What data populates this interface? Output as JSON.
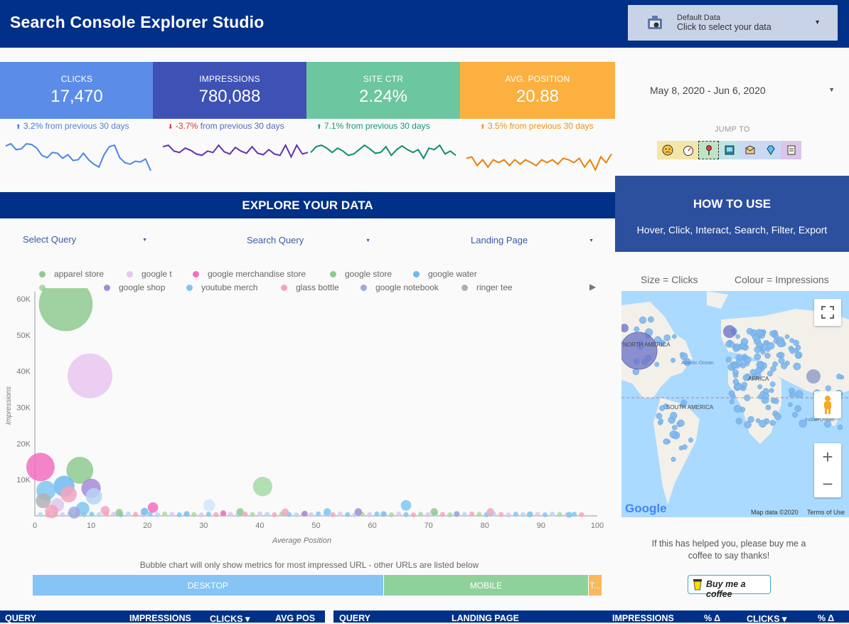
{
  "header": {
    "title": "Search Console Explorer Studio",
    "data_selector": {
      "label": "Default Data",
      "value": "Click to select your data"
    }
  },
  "colors": {
    "navy": "#003087",
    "clicks": "#5b8de8",
    "impressions": "#3e51b5",
    "ctr": "#6cc6a0",
    "position": "#fbb040",
    "howto_bg": "#2c4f9e"
  },
  "kpis": [
    {
      "label": "CLICKS",
      "value": "17,470",
      "change": "3.2%",
      "change_text": "from previous 30 days",
      "direction": "up"
    },
    {
      "label": "IMPRESSIONS",
      "value": "780,088",
      "change": "-3.7%",
      "change_text": "from previous 30 days",
      "direction": "down"
    },
    {
      "label": "SITE CTR",
      "value": "2.24%",
      "change": "7.1%",
      "change_text": "from previous 30 days",
      "direction": "up"
    },
    {
      "label": "AVG. POSITION",
      "value": "20.88",
      "change": "3.5%",
      "change_text": "from previous 30 days",
      "direction": "up"
    }
  ],
  "sparklines": {
    "clicks": [
      41,
      44,
      36,
      37,
      44,
      43,
      38,
      28,
      25,
      32,
      31,
      24,
      29,
      21,
      22,
      31,
      22,
      16,
      12,
      29,
      40,
      42,
      25,
      18,
      16,
      20,
      19,
      23,
      7
    ],
    "impressions": [
      40,
      42,
      34,
      32,
      38,
      35,
      30,
      28,
      34,
      32,
      42,
      33,
      30,
      39,
      34,
      31,
      40,
      31,
      29,
      36,
      30,
      28,
      42,
      26,
      42,
      30,
      32
    ],
    "ctr": [
      32,
      40,
      42,
      38,
      32,
      38,
      34,
      28,
      30,
      36,
      42,
      37,
      31,
      32,
      40,
      28,
      36,
      41,
      36,
      32,
      36,
      24,
      38,
      36,
      42,
      30,
      34,
      28
    ],
    "position": [
      24,
      26,
      14,
      22,
      12,
      22,
      18,
      22,
      14,
      22,
      16,
      22,
      18,
      14,
      22,
      18,
      22,
      16,
      24,
      22,
      18,
      24,
      12,
      22,
      8,
      26,
      18,
      30
    ]
  },
  "date_range": "May 8, 2020 - Jun 6, 2020",
  "jump_to": {
    "label": "JUMP TO",
    "buttons": [
      {
        "icon": "sad-face-icon",
        "bg": "#f4e6a8"
      },
      {
        "icon": "gauge-icon",
        "bg": "#f4e6a8"
      },
      {
        "icon": "map-pin-icon",
        "bg": "#bfe3c5"
      },
      {
        "icon": "book-icon",
        "bg": "#bfe3e8"
      },
      {
        "icon": "folder-icon",
        "bg": "#c9d9f4"
      },
      {
        "icon": "diamond-icon",
        "bg": "#c9d9f4"
      },
      {
        "icon": "scroll-icon",
        "bg": "#dcc5ea"
      }
    ]
  },
  "howto": {
    "title": "HOW TO USE",
    "text": "Hover, Click, Interact, Search, Filter, Export"
  },
  "explore": {
    "title": "EXPLORE YOUR DATA"
  },
  "filters": [
    {
      "label": "Select Query"
    },
    {
      "label": "Search Query"
    },
    {
      "label": "Landing Page"
    }
  ],
  "chart_data": {
    "type": "scatter",
    "xlabel": "Average Position",
    "ylabel": "Impressions",
    "xlim": [
      0,
      100
    ],
    "ylim": [
      0,
      60000
    ],
    "xticks": [
      "0",
      "10",
      "20",
      "30",
      "40",
      "50",
      "60",
      "70",
      "80",
      "90",
      "100"
    ],
    "yticks": [
      "10K",
      "20K",
      "30K",
      "40K",
      "50K",
      "60K"
    ],
    "legend": [
      {
        "name": "apparel store",
        "color": "#8fc98f"
      },
      {
        "name": "google t",
        "color": "#e8c6ee"
      },
      {
        "name": "google merchandise store",
        "color": "#f26fbf"
      },
      {
        "name": "google store",
        "color": "#8fc98f"
      },
      {
        "name": "google water",
        "color": "#6fb8f0"
      },
      {
        "name": "",
        "color": "#a6d9a6"
      },
      {
        "name": "google shop",
        "color": "#a58bd8"
      },
      {
        "name": "youtube merch",
        "color": "#7fc6f2"
      },
      {
        "name": "glass bottle",
        "color": "#f3a3c0"
      },
      {
        "name": "google notebook",
        "color": "#9fa8e0"
      },
      {
        "name": "ringer tee",
        "color": "#b0b0b0"
      }
    ],
    "points": [
      {
        "x": 5.5,
        "y": 58500,
        "size": 36,
        "color": "#8fc98f"
      },
      {
        "x": 9.8,
        "y": 38700,
        "size": 30,
        "color": "#e8c6ee"
      },
      {
        "x": 1,
        "y": 13500,
        "size": 19,
        "color": "#f26fbf"
      },
      {
        "x": 8,
        "y": 12600,
        "size": 18,
        "color": "#8fc98f"
      },
      {
        "x": 5.2,
        "y": 8200,
        "size": 14,
        "color": "#6fb8f0"
      },
      {
        "x": 10,
        "y": 7600,
        "size": 13,
        "color": "#a58bd8"
      },
      {
        "x": 2,
        "y": 7000,
        "size": 13,
        "color": "#7fc6f2"
      },
      {
        "x": 6,
        "y": 6000,
        "size": 11,
        "color": "#f3a3c0"
      },
      {
        "x": 10.5,
        "y": 5400,
        "size": 11,
        "color": "#b9d3f5"
      },
      {
        "x": 1.5,
        "y": 4200,
        "size": 10,
        "color": "#b0b0b0"
      },
      {
        "x": 4,
        "y": 3000,
        "size": 9,
        "color": "#d9c6ee"
      },
      {
        "x": 8.5,
        "y": 2000,
        "size": 9,
        "color": "#7fc6f2"
      },
      {
        "x": 12.5,
        "y": 1500,
        "size": 6,
        "color": "#f3a3c0"
      },
      {
        "x": 3,
        "y": 1200,
        "size": 9,
        "color": "#f3a3c0"
      },
      {
        "x": 7,
        "y": 900,
        "size": 8,
        "color": "#9fa8e0"
      },
      {
        "x": 40.5,
        "y": 8100,
        "size": 13,
        "color": "#a6d9a6"
      },
      {
        "x": 21,
        "y": 2300,
        "size": 7,
        "color": "#f26fbf"
      },
      {
        "x": 31,
        "y": 2900,
        "size": 8,
        "color": "#cfe6f8"
      },
      {
        "x": 66,
        "y": 2900,
        "size": 7,
        "color": "#7fc6f2"
      },
      {
        "x": 15,
        "y": 900,
        "size": 5,
        "color": "#8fc98f"
      },
      {
        "x": 19.5,
        "y": 1200,
        "size": 5,
        "color": "#6fb8f0"
      },
      {
        "x": 36.5,
        "y": 1100,
        "size": 5,
        "color": "#8fc98f"
      },
      {
        "x": 44.5,
        "y": 1000,
        "size": 5,
        "color": "#f3a3c0"
      },
      {
        "x": 52,
        "y": 1100,
        "size": 5,
        "color": "#7fc6f2"
      },
      {
        "x": 57.5,
        "y": 1100,
        "size": 5,
        "color": "#a58bd8"
      },
      {
        "x": 71,
        "y": 1100,
        "size": 5,
        "color": "#8fc98f"
      },
      {
        "x": 81,
        "y": 1100,
        "size": 5,
        "color": "#f3a3c0"
      },
      {
        "x": 33.5,
        "y": 700,
        "size": 4,
        "color": "#f26fbf"
      },
      {
        "x": 27,
        "y": 500,
        "size": 4,
        "color": "#7fc6f2"
      },
      {
        "x": 48,
        "y": 600,
        "size": 4,
        "color": "#a58bd8"
      },
      {
        "x": 62,
        "y": 500,
        "size": 4,
        "color": "#7fc6f2"
      },
      {
        "x": 75,
        "y": 500,
        "size": 4,
        "color": "#9fa8e0"
      },
      {
        "x": 88,
        "y": 400,
        "size": 4,
        "color": "#7fc6f2"
      },
      {
        "x": 95,
        "y": 300,
        "size": 4,
        "color": "#7fc6f2"
      }
    ]
  },
  "map": {
    "caption_size": "Size = Clicks",
    "caption_colour": "Colour = Impressions",
    "attribution": "Map data ©2020",
    "terms": "Terms of Use",
    "logo": "Google",
    "labels": [
      "NORTH AMERICA",
      "SOUTH AMERICA",
      "AFRICA",
      "Atlantic Ocean",
      "Indian Ocean"
    ]
  },
  "thanks_text": "If this has helped you, please buy me a coffee to say thanks!",
  "coffee_button": "Buy me a coffee",
  "device": {
    "note": "Bubble chart will only show metrics for most impressed URL - other URLs are listed below",
    "segments": [
      {
        "label": "DESKTOP",
        "share": 0.617,
        "color": "#85c4f4"
      },
      {
        "label": "MOBILE",
        "share": 0.361,
        "color": "#8fd19a"
      },
      {
        "label": "T...",
        "share": 0.022,
        "color": "#f7b95a"
      }
    ]
  },
  "tables": {
    "left": [
      "QUERY",
      "IMPRESSIONS",
      "CLICKS ▾",
      "AVG POS"
    ],
    "right": [
      "QUERY",
      "LANDING PAGE",
      "IMPRESSIONS",
      "% Δ",
      "CLICKS ▾",
      "% Δ"
    ]
  }
}
